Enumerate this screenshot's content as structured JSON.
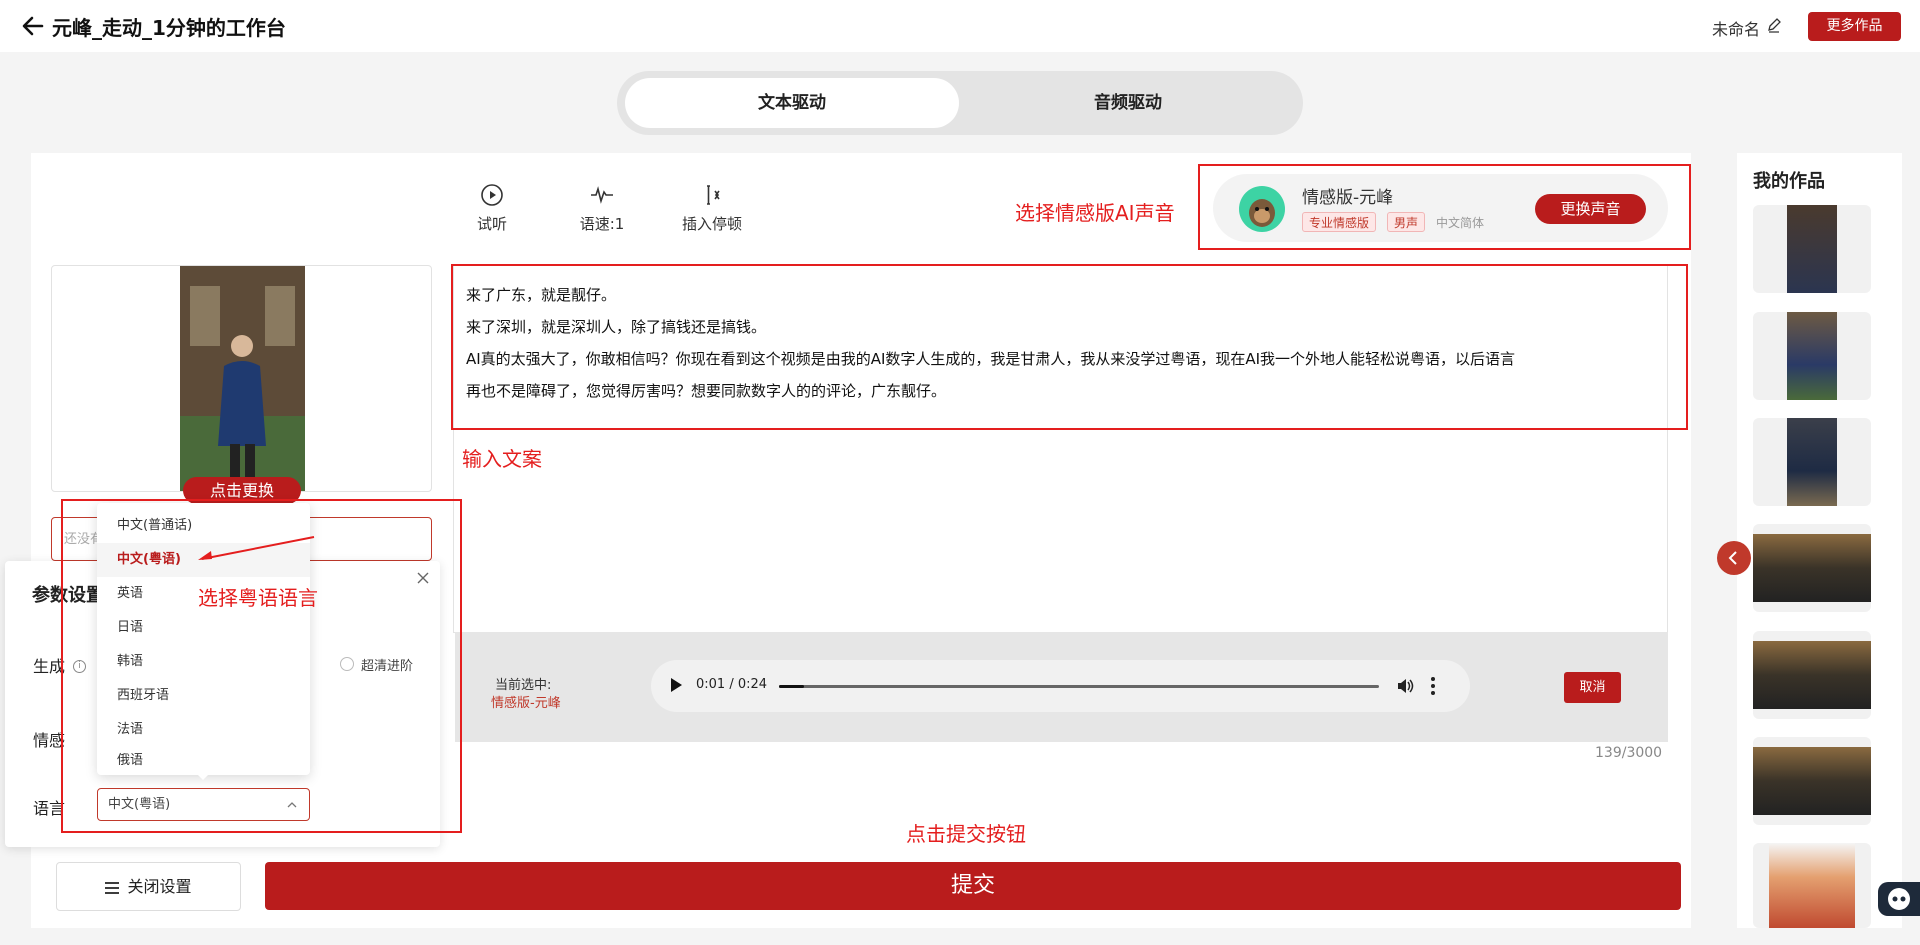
{
  "header": {
    "title": "元峰_走动_1分钟的工作台",
    "project_name": "未命名",
    "more_works_label": "更多作品"
  },
  "mode_tabs": [
    "文本驱动",
    "音频驱动"
  ],
  "tools": {
    "listen": "试听",
    "speed": "语速:1",
    "pause": "插入停顿"
  },
  "voice": {
    "name": "情感版-元峰",
    "tags": [
      "专业情感版",
      "男声"
    ],
    "language": "中文简体",
    "change_label": "更换声音"
  },
  "avatar": {
    "change_label": "点击更换",
    "name_placeholder": "还没有"
  },
  "script_lines": [
    "来了广东，就是靓仔。",
    "来了深圳，就是深圳人，除了搞钱还是搞钱。",
    "AI真的太强大了，你敢相信吗？你现在看到这个视频是由我的AI数字人生成的，我是甘肃人，我从来没学过粤语，现在AI我一个外地人能轻松说粤语，以后语言",
    "再也不是障碍了，您觉得厉害吗？想要同款数字人的的评论，广东靓仔。"
  ],
  "player": {
    "current_label": "当前选中:",
    "current_value": "情感版-元峰",
    "time": "0:01 / 0:24",
    "progress": 0.042,
    "cancel_label": "取消"
  },
  "char_count": "139/3000",
  "params": {
    "title": "参数设置",
    "generate_label": "生成",
    "radio_label": "超清进阶",
    "emotion_label": "情感",
    "language_label": "语言",
    "language_value": "中文(粤语)"
  },
  "language_options": [
    "中文(普通话)",
    "中文(粤语)",
    "英语",
    "日语",
    "韩语",
    "西班牙语",
    "法语",
    "俄语"
  ],
  "selected_language": "中文(粤语)",
  "close_settings_label": "关闭设置",
  "submit_label": "提交",
  "works": {
    "title": "我的作品"
  },
  "annotations": {
    "voice": "选择情感版AI声音",
    "script": "输入文案",
    "language": "选择粤语语言",
    "submit": "点击提交按钮"
  },
  "colors": {
    "brand": "#b91c1c",
    "annotation": "#e41e1e"
  }
}
